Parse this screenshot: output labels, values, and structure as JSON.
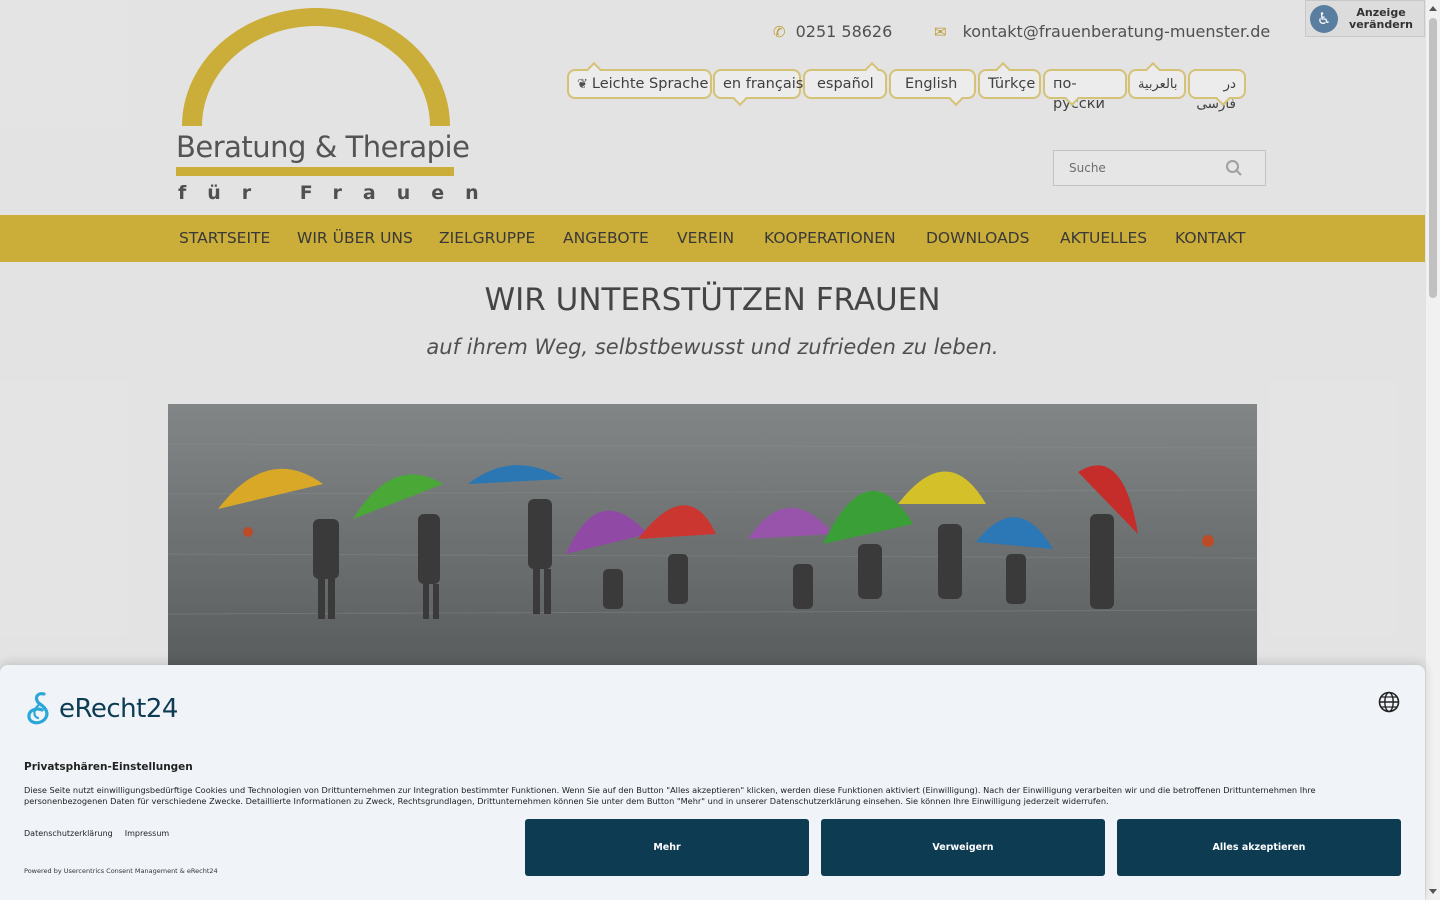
{
  "logo": {
    "title": "Beratung & Therapie",
    "subtitle": "für Frauen"
  },
  "contact": {
    "phone": "0251 58626",
    "email": "kontakt@frauenberatung-muenster.de"
  },
  "accessibility": {
    "label_line1": "Anzeige",
    "label_line2": "verändern"
  },
  "languages": [
    {
      "label": "Leichte Sprache"
    },
    {
      "label": "en français"
    },
    {
      "label": "español"
    },
    {
      "label": "English"
    },
    {
      "label": "Türkçe"
    },
    {
      "label": "по-русски"
    },
    {
      "label": "بالعربية"
    },
    {
      "label": "در فارسی"
    }
  ],
  "search": {
    "placeholder": "Suche"
  },
  "nav": [
    {
      "label": "STARTSEITE"
    },
    {
      "label": "WIR ÜBER UNS"
    },
    {
      "label": "ZIELGRUPPE"
    },
    {
      "label": "ANGEBOTE"
    },
    {
      "label": "VEREIN"
    },
    {
      "label": "KOOPERATIONEN"
    },
    {
      "label": "DOWNLOADS"
    },
    {
      "label": "AKTUELLES"
    },
    {
      "label": "KONTAKT"
    }
  ],
  "hero": {
    "title": "WIR UNTERSTÜTZEN FRAUEN",
    "subtitle": "auf ihrem Weg, selbstbewusst und zufrieden zu leben."
  },
  "consent": {
    "brand": "eRecht24",
    "title": "Privatsphären-Einstellungen",
    "text": "Diese Seite nutzt einwilligungsbedürftige Cookies und Technologien von Drittunternehmen zur Integration bestimmter Funktionen. Wenn Sie auf den Button \"Alles akzeptieren\" klicken, werden diese Funktionen aktiviert (Einwilligung). Nach der Einwilligung verarbeiten wir und die betroffenen Drittunternehmen Ihre personenbezogenen Daten für verschiedene Zwecke. Detaillierte Informationen zu Zweck, Rechtsgrundlagen, Drittunternehmen können Sie unter dem Button \"Mehr\" und in unserer Datenschutzerklärung einsehen. Sie können Ihre Einwilligung jederzeit widerrufen.",
    "link_privacy": "Datenschutzerklärung",
    "link_imprint": "Impressum",
    "powered": "Powered by Usercentrics Consent Management & eRecht24",
    "btn_more": "Mehr",
    "btn_deny": "Verweigern",
    "btn_accept": "Alles akzeptieren"
  },
  "colors": {
    "accent": "#d8b83d",
    "consent_button": "#0d3b52"
  }
}
